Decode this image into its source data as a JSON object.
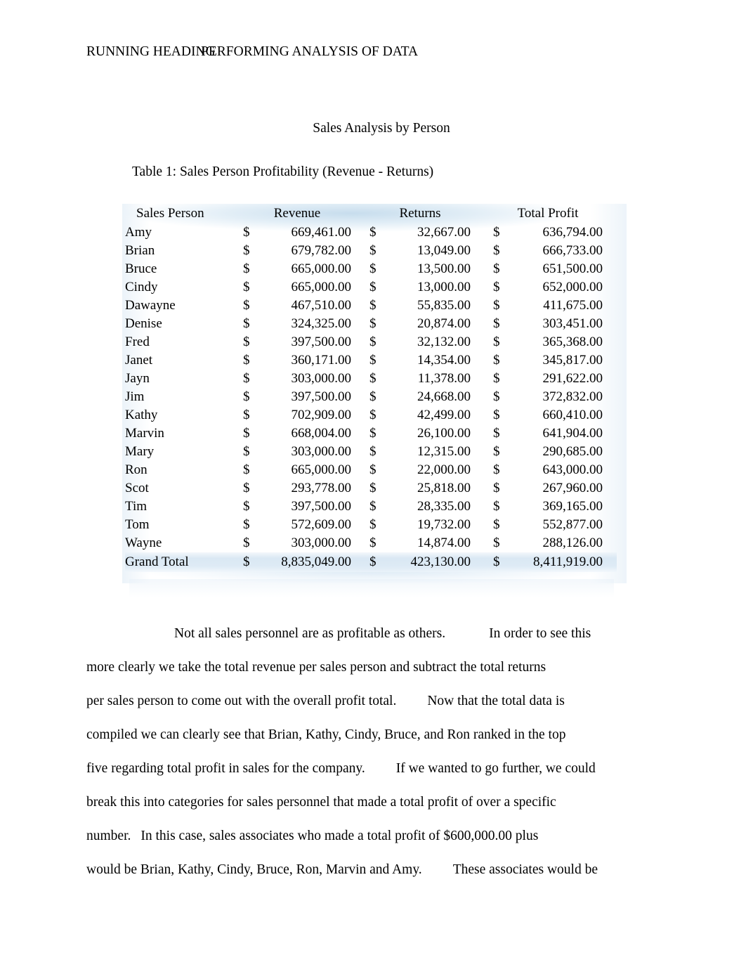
{
  "header": {
    "running_head_label": "RUNNING HEADING",
    "running_head_title": "PERFORMING ANALYSIS OF DATA"
  },
  "title": "Sales Analysis by Person",
  "table": {
    "caption": "Table 1: Sales Person Profitability (Revenue - Returns)",
    "currency_symbol": "$",
    "columns": [
      "Sales Person",
      "Revenue",
      "Returns",
      "Total Profit"
    ],
    "rows": [
      {
        "name": "Amy",
        "revenue": "669,461.00",
        "returns": "32,667.00",
        "profit": "636,794.00"
      },
      {
        "name": "Brian",
        "revenue": "679,782.00",
        "returns": "13,049.00",
        "profit": "666,733.00"
      },
      {
        "name": "Bruce",
        "revenue": "665,000.00",
        "returns": "13,500.00",
        "profit": "651,500.00"
      },
      {
        "name": "Cindy",
        "revenue": "665,000.00",
        "returns": "13,000.00",
        "profit": "652,000.00"
      },
      {
        "name": "Dawayne",
        "revenue": "467,510.00",
        "returns": "55,835.00",
        "profit": "411,675.00"
      },
      {
        "name": "Denise",
        "revenue": "324,325.00",
        "returns": "20,874.00",
        "profit": "303,451.00"
      },
      {
        "name": "Fred",
        "revenue": "397,500.00",
        "returns": "32,132.00",
        "profit": "365,368.00"
      },
      {
        "name": "Janet",
        "revenue": "360,171.00",
        "returns": "14,354.00",
        "profit": "345,817.00"
      },
      {
        "name": "Jayn",
        "revenue": "303,000.00",
        "returns": "11,378.00",
        "profit": "291,622.00"
      },
      {
        "name": "Jim",
        "revenue": "397,500.00",
        "returns": "24,668.00",
        "profit": "372,832.00"
      },
      {
        "name": "Kathy",
        "revenue": "702,909.00",
        "returns": "42,499.00",
        "profit": "660,410.00"
      },
      {
        "name": "Marvin",
        "revenue": "668,004.00",
        "returns": "26,100.00",
        "profit": "641,904.00"
      },
      {
        "name": "Mary",
        "revenue": "303,000.00",
        "returns": "12,315.00",
        "profit": "290,685.00"
      },
      {
        "name": "Ron",
        "revenue": "665,000.00",
        "returns": "22,000.00",
        "profit": "643,000.00"
      },
      {
        "name": "Scot",
        "revenue": "293,778.00",
        "returns": "25,818.00",
        "profit": "267,960.00"
      },
      {
        "name": "Tim",
        "revenue": "397,500.00",
        "returns": "28,335.00",
        "profit": "369,165.00"
      },
      {
        "name": "Tom",
        "revenue": "572,609.00",
        "returns": "19,732.00",
        "profit": "552,877.00"
      },
      {
        "name": "Wayne",
        "revenue": "303,000.00",
        "returns": "14,874.00",
        "profit": "288,126.00"
      }
    ],
    "total_row": {
      "name": "Grand Total",
      "revenue": "8,835,049.00",
      "returns": "423,130.00",
      "profit": "8,411,919.00"
    },
    "accent_color": "#dbe9f4"
  },
  "body": {
    "lines": [
      "Not all sales personnel are as profitable as others.",
      "In order to see this",
      "more clearly we take the total revenue per sales person and subtract the total returns",
      "per sales person to come out with the overall profit total.",
      "Now that the total data is",
      "compiled we can clearly see that Brian, Kathy, Cindy, Bruce, and Ron ranked in the top",
      "five regarding total profit in sales for the company.",
      "If we wanted to go further, we could",
      "break this into categories for sales personnel that made a total profit of over a specific",
      "number.",
      "In this case, sales associates who made a total profit of $600,000.00 plus",
      "would be Brian, Kathy, Cindy, Bruce, Ron, Marvin and Amy.",
      "These associates would be"
    ]
  }
}
